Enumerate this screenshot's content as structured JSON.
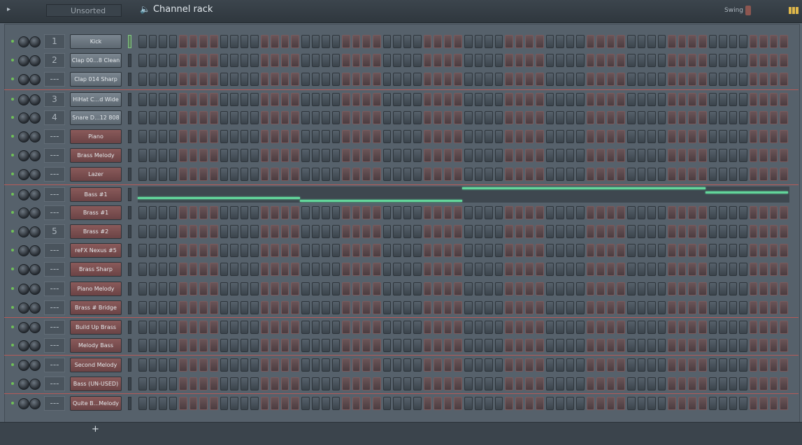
{
  "titlebar": {
    "group": "Unsorted",
    "title": "Channel rack",
    "swing_label": "Swing"
  },
  "channels": [
    {
      "num": "1",
      "name": "Kick",
      "color": "gray"
    },
    {
      "num": "2",
      "name": "Clap 00...8 Clean",
      "color": "gray"
    },
    {
      "num": "---",
      "name": "Clap 014 Sharp",
      "color": "gray"
    },
    {
      "num": "3",
      "name": "HiHat C...d Wide",
      "color": "gray"
    },
    {
      "num": "4",
      "name": "Snare D...12 808",
      "color": "gray"
    },
    {
      "num": "---",
      "name": "Piano",
      "color": "red"
    },
    {
      "num": "---",
      "name": "Brass Melody",
      "color": "red"
    },
    {
      "num": "---",
      "name": "Lazer",
      "color": "red"
    },
    {
      "num": "---",
      "name": "Bass #1",
      "color": "red"
    },
    {
      "num": "---",
      "name": "Brass #1",
      "color": "red"
    },
    {
      "num": "5",
      "name": "Brass #2",
      "color": "red"
    },
    {
      "num": "---",
      "name": "reFX Nexus #5",
      "color": "red"
    },
    {
      "num": "---",
      "name": "Brass Sharp",
      "color": "red"
    },
    {
      "num": "---",
      "name": "Piano Melody",
      "color": "red"
    },
    {
      "num": "---",
      "name": "Brass # Bridge",
      "color": "red"
    },
    {
      "num": "---",
      "name": "Build Up Brass",
      "color": "red"
    },
    {
      "num": "---",
      "name": "Melody Bass",
      "color": "red"
    },
    {
      "num": "---",
      "name": "Second Melody",
      "color": "red"
    },
    {
      "num": "---",
      "name": "Bass (UN-USED)",
      "color": "red"
    },
    {
      "num": "---",
      "name": "Quite B...Melody",
      "color": "red"
    }
  ],
  "bottom": {
    "add_button": "+"
  }
}
